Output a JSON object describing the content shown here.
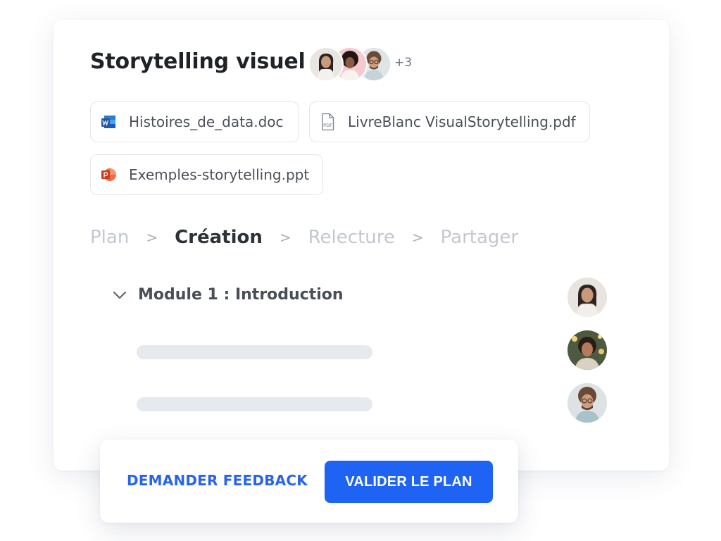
{
  "project": {
    "title": "Storytelling visuel",
    "collaborators_more": "+3"
  },
  "files": [
    {
      "name": "Histoires_de_data.doc",
      "icon": "word-icon"
    },
    {
      "name": "LivreBlanc VisualStorytelling.pdf",
      "icon": "pdf-icon"
    },
    {
      "name": "Exemples-storytelling.ppt",
      "icon": "powerpoint-icon"
    }
  ],
  "steps": [
    {
      "label": "Plan",
      "active": false
    },
    {
      "label": "Création",
      "active": true
    },
    {
      "label": "Relecture",
      "active": false
    },
    {
      "label": "Partager",
      "active": false
    }
  ],
  "step_separator": ">",
  "module": {
    "title": "Module 1 : Introduction",
    "expanded": true
  },
  "actions": {
    "feedback_label": "DEMANDER FEEDBACK",
    "validate_label": "VALIDER LE PLAN"
  },
  "colors": {
    "accent": "#1f63f5",
    "link": "#2a64e6",
    "word": "#2b579a",
    "powerpoint": "#d24726"
  }
}
